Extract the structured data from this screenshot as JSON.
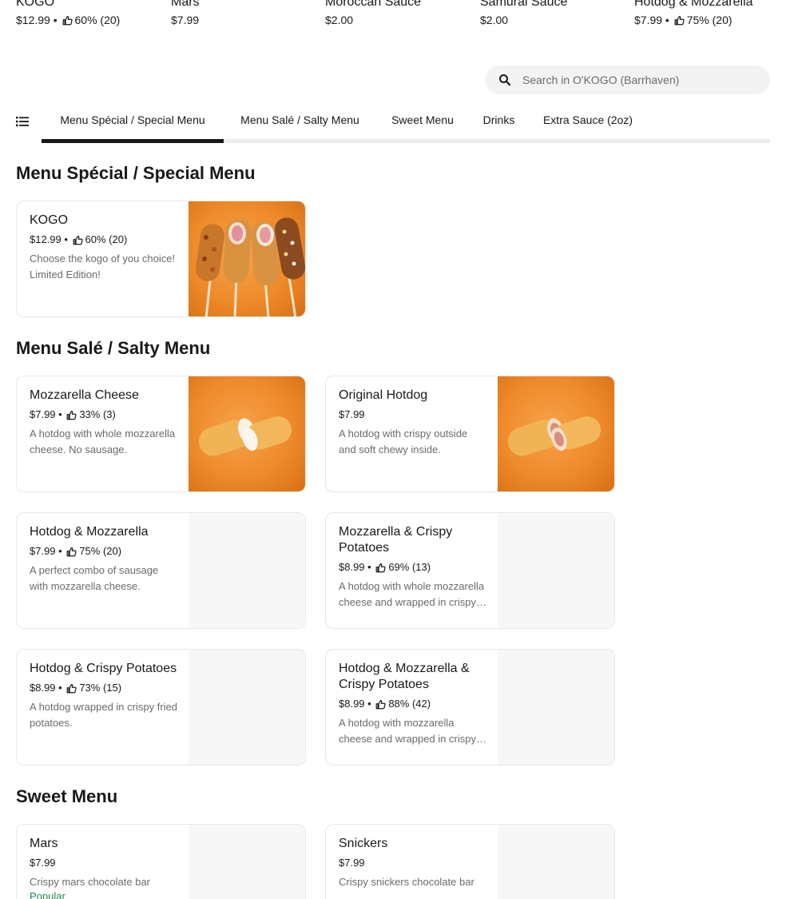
{
  "featured": [
    {
      "name": "KOGO",
      "price": "$12.99",
      "rating": "60% (20)"
    },
    {
      "name": "Mars",
      "price": "$7.99",
      "rating": ""
    },
    {
      "name": "Moroccan Sauce",
      "price": "$2.00",
      "rating": ""
    },
    {
      "name": "Samurai Sauce",
      "price": "$2.00",
      "rating": ""
    },
    {
      "name": "Hotdog & Mozzarella",
      "price": "$7.99",
      "rating": "75% (20)"
    }
  ],
  "search": {
    "placeholder": "Search in O'KOGO (Barrhaven)"
  },
  "tabs": [
    {
      "label": "Menu Spécial / Special Menu"
    },
    {
      "label": "Menu Salé / Salty Menu"
    },
    {
      "label": "Sweet Menu"
    },
    {
      "label": "Drinks"
    },
    {
      "label": "Extra Sauce (2oz)"
    }
  ],
  "sections": {
    "special": {
      "title": "Menu Spécial / Special Menu",
      "items": [
        {
          "name": "KOGO",
          "price": "$12.99",
          "rating": "60% (20)",
          "desc": "Choose the kogo of you choice! Limited Edition!"
        }
      ]
    },
    "salty": {
      "title": "Menu Salé / Salty Menu",
      "items": [
        {
          "name": "Mozzarella Cheese",
          "price": "$7.99",
          "rating": "33% (3)",
          "desc": "A hotdog with whole mozzarella cheese. No sausage."
        },
        {
          "name": "Original Hotdog",
          "price": "$7.99",
          "rating": "",
          "desc": "A hotdog with crispy outside and soft chewy inside."
        },
        {
          "name": "Hotdog & Mozzarella",
          "price": "$7.99",
          "rating": "75% (20)",
          "desc": "A perfect combo of sausage with mozzarella cheese."
        },
        {
          "name": "Mozzarella & Crispy Potatoes",
          "price": "$8.99",
          "rating": "69% (13)",
          "desc": "A hotdog with whole mozzarella cheese and wrapped in crispy potatoes."
        },
        {
          "name": "Hotdog & Crispy Potatoes",
          "price": "$8.99",
          "rating": "73% (15)",
          "desc": "A hotdog wrapped in crispy fried potatoes."
        },
        {
          "name": "Hotdog & Mozzarella & Crispy Potatoes",
          "price": "$8.99",
          "rating": "88% (42)",
          "desc": "A hotdog with mozzarella cheese and wrapped in crispy potatoes."
        }
      ]
    },
    "sweet": {
      "title": "Sweet Menu",
      "items": [
        {
          "name": "Mars",
          "price": "$7.99",
          "rating": "",
          "desc": "Crispy mars chocolate bar",
          "badge": "Popular"
        },
        {
          "name": "Snickers",
          "price": "$7.99",
          "rating": "",
          "desc": "Crispy snickers chocolate bar"
        }
      ]
    }
  },
  "rating_separator": " • ",
  "colors": {
    "accent": "#191919",
    "tab_track": "#ececec",
    "image_orange": "#ee8a2a",
    "popular": "#1f8a4c"
  }
}
